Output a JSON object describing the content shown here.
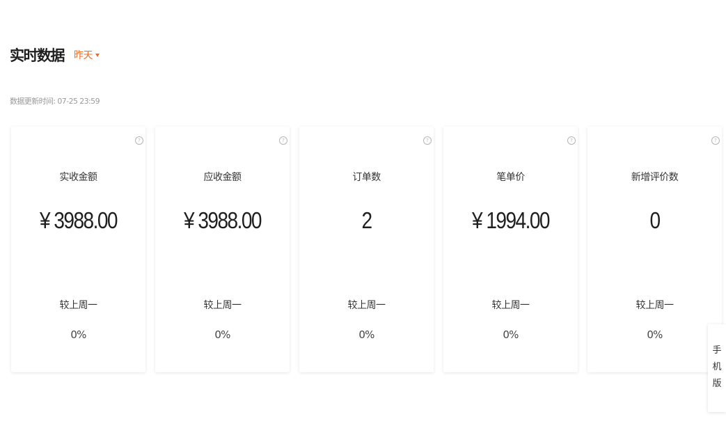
{
  "header": {
    "title": "实时数据",
    "period_label": "昨天"
  },
  "updated_text": "数据更新时间: 07-25 23:59",
  "cards": [
    {
      "label": "实收金额",
      "value": "¥ 3988.00",
      "compare_label": "较上周一",
      "compare_value": "0%"
    },
    {
      "label": "应收金额",
      "value": "¥ 3988.00",
      "compare_label": "较上周一",
      "compare_value": "0%"
    },
    {
      "label": "订单数",
      "value": "2",
      "compare_label": "较上周一",
      "compare_value": "0%"
    },
    {
      "label": "笔单价",
      "value": "¥ 1994.00",
      "compare_label": "较上周一",
      "compare_value": "0%"
    },
    {
      "label": "新增评价数",
      "value": "0",
      "compare_label": "较上周一",
      "compare_value": "0%"
    }
  ],
  "help_icon_glyph": "?",
  "mobile_tab": {
    "chars": [
      "手",
      "机",
      "版"
    ]
  },
  "colors": {
    "accent": "#f36d1f",
    "muted_text": "#9a9a9a"
  },
  "icons": {
    "help": "question-circle-icon",
    "dropdown": "caret-down-icon"
  }
}
